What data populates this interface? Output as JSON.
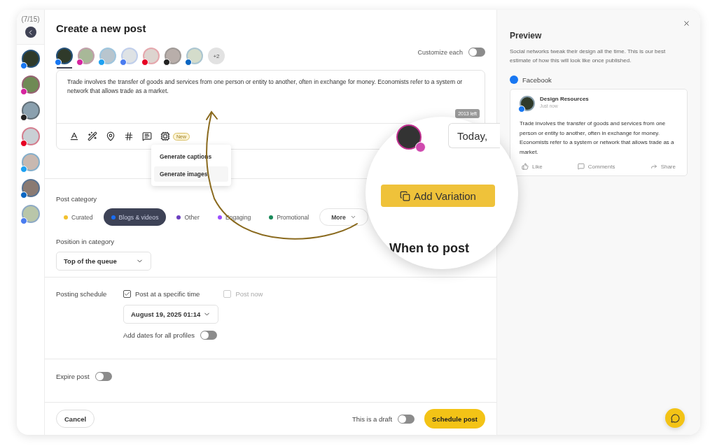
{
  "rail": {
    "counter": "(7/15)",
    "profiles": [
      {
        "color": "#1877f2"
      },
      {
        "color": "#d6249f"
      },
      {
        "color": "#222222"
      },
      {
        "color": "#e60023"
      },
      {
        "color": "#1da1f2"
      },
      {
        "color": "#0a66c2"
      },
      {
        "color": "#4a7cf0"
      }
    ]
  },
  "composer": {
    "title": "Create a new post",
    "profiles": [
      {
        "color": "#1877f2",
        "selected": true
      },
      {
        "color": "#d6249f",
        "selected": false
      },
      {
        "color": "#1da1f2",
        "selected": false
      },
      {
        "color": "#4a7cf0",
        "selected": false
      },
      {
        "color": "#e60023",
        "selected": false
      },
      {
        "color": "#222222",
        "selected": false
      },
      {
        "color": "#0a66c2",
        "selected": false
      }
    ],
    "more_profiles": "+2",
    "customize_label": "Customize each",
    "customize_on": false,
    "text": "Trade involves the transfer of goods and services from one person or entity to another, often in exchange for money. Economists refer to a system or network that allows trade as a market.",
    "chars_left": "2013 left",
    "ai_badge": "New",
    "ai_menu": [
      "Generate captions",
      "Generate images"
    ]
  },
  "magnifier": {
    "today": "Today,",
    "add_variation": "Add Variation",
    "heading": "When to post"
  },
  "category": {
    "label": "Post category",
    "items": [
      {
        "label": "Curated",
        "color": "#f2c12e",
        "selected": false
      },
      {
        "label": "Blogs & videos",
        "color": "#1a6ef5",
        "selected": true
      },
      {
        "label": "Other",
        "color": "#6b3fbf",
        "selected": false
      },
      {
        "label": "Engaging",
        "color": "#9b4dff",
        "selected": false
      },
      {
        "label": "Promotional",
        "color": "#1a8a5a",
        "selected": false
      }
    ],
    "more": "More"
  },
  "position": {
    "label": "Position in category",
    "value": "Top of the queue"
  },
  "schedule": {
    "label": "Posting schedule",
    "options": [
      {
        "label": "Post at a specific time",
        "checked": true,
        "disabled": false
      },
      {
        "label": "Post now",
        "checked": false,
        "disabled": true
      }
    ],
    "date": "August 19, 2025 01:14",
    "all_profiles_label": "Add dates for all profiles",
    "all_profiles_on": false
  },
  "expire": {
    "label": "Expire post",
    "on": false
  },
  "footer": {
    "cancel": "Cancel",
    "draft_label": "This is a draft",
    "draft_on": false,
    "schedule": "Schedule post"
  },
  "preview": {
    "title": "Preview",
    "description": "Social networks tweak their design all the time. This is our best estimate of how this will look like once published.",
    "network": "Facebook",
    "post": {
      "author": "Design Resources",
      "time": "Just now",
      "text": "Trade involves the transfer of goods and services from one person or entity to another, often in exchange for money. Economists refer to a system or network that allows trade as a market.",
      "actions": [
        "Like",
        "Comments",
        "Share"
      ]
    }
  }
}
